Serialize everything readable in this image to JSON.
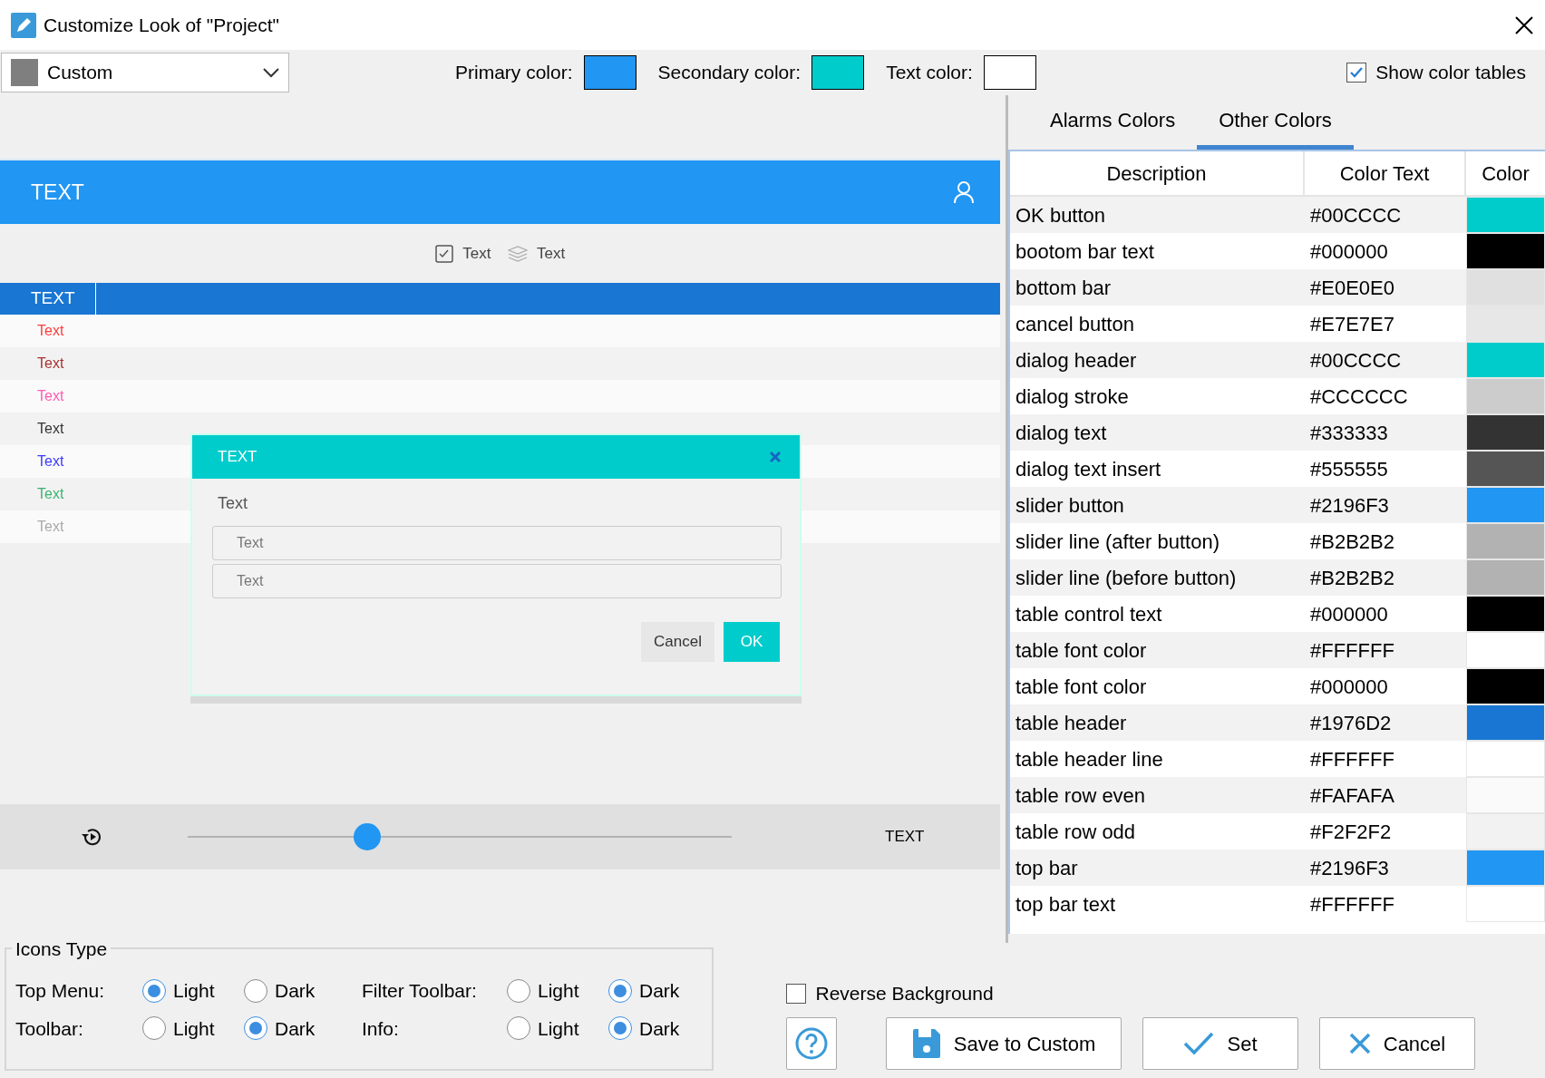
{
  "window": {
    "title": "Customize Look of \"Project\""
  },
  "scheme": {
    "value": "Custom"
  },
  "colors": [
    {
      "label": "Primary color:",
      "color": "#2196F3"
    },
    {
      "label": "Secondary color:",
      "color": "#00CCCC"
    },
    {
      "label": "Text color:",
      "color": "#FFFFFF"
    }
  ],
  "show_color_tables": {
    "label": "Show color tables",
    "checked": true
  },
  "preview": {
    "top_bar": {
      "title": "TEXT"
    },
    "toolbar": [
      {
        "kind": "check",
        "label": "Text"
      },
      {
        "kind": "layers",
        "label": "Text"
      }
    ],
    "table": {
      "header": "TEXT",
      "rows": [
        {
          "text": "Text",
          "color": "#FF3B3B"
        },
        {
          "text": "Text",
          "color": "#A83232"
        },
        {
          "text": "Text",
          "color": "#FF5CB0"
        },
        {
          "text": "Text",
          "color": "#333333"
        },
        {
          "text": "Text",
          "color": "#3A3AFF"
        },
        {
          "text": "Text",
          "color": "#3CB371"
        },
        {
          "text": "Text",
          "color": "#AAAAAA"
        }
      ]
    },
    "dialog": {
      "title": "TEXT",
      "label": "Text",
      "fields": [
        {
          "placeholder": "Text"
        },
        {
          "placeholder": "Text"
        }
      ],
      "buttons": [
        {
          "kind": "cancel",
          "label": "Cancel"
        },
        {
          "kind": "ok",
          "label": "OK"
        }
      ]
    },
    "bottom_bar": {
      "slider": {
        "level": 0.33
      },
      "label": "TEXT"
    }
  },
  "tabs": [
    {
      "label": "Alarms Colors",
      "selected": false
    },
    {
      "label": "Other Colors",
      "selected": true
    }
  ],
  "color_table": {
    "columns": [
      "Description",
      "Color Text",
      "Color"
    ],
    "rows": [
      {
        "description": "OK button",
        "color_text": "#00CCCC",
        "color": "#00CCCC"
      },
      {
        "description": "bootom bar text",
        "color_text": "#000000",
        "color": "#000000"
      },
      {
        "description": "bottom bar",
        "color_text": "#E0E0E0",
        "color": "#E0E0E0"
      },
      {
        "description": "cancel button",
        "color_text": "#E7E7E7",
        "color": "#E7E7E7"
      },
      {
        "description": "dialog header",
        "color_text": "#00CCCC",
        "color": "#00CCCC"
      },
      {
        "description": "dialog stroke",
        "color_text": "#CCCCCC",
        "color": "#CCCCCC"
      },
      {
        "description": "dialog text",
        "color_text": "#333333",
        "color": "#333333"
      },
      {
        "description": "dialog text insert",
        "color_text": "#555555",
        "color": "#555555"
      },
      {
        "description": "slider button",
        "color_text": "#2196F3",
        "color": "#2196F3"
      },
      {
        "description": "slider line (after button)",
        "color_text": "#B2B2B2",
        "color": "#B2B2B2"
      },
      {
        "description": "slider line (before button)",
        "color_text": "#B2B2B2",
        "color": "#B2B2B2"
      },
      {
        "description": "table control text",
        "color_text": "#000000",
        "color": "#000000"
      },
      {
        "description": "table font color",
        "color_text": "#FFFFFF",
        "color": "#FFFFFF"
      },
      {
        "description": "table font color",
        "color_text": "#000000",
        "color": "#000000"
      },
      {
        "description": "table header",
        "color_text": "#1976D2",
        "color": "#1976D2"
      },
      {
        "description": "table header line",
        "color_text": "#FFFFFF",
        "color": "#FFFFFF"
      },
      {
        "description": "table row even",
        "color_text": "#FAFAFA",
        "color": "#FAFAFA"
      },
      {
        "description": "table row odd",
        "color_text": "#F2F2F2",
        "color": "#F2F2F2"
      },
      {
        "description": "top bar",
        "color_text": "#2196F3",
        "color": "#2196F3"
      },
      {
        "description": "top bar text",
        "color_text": "#FFFFFF",
        "color": "#FFFFFF"
      }
    ]
  },
  "icons_type": {
    "title": "Icons Type",
    "groups": [
      {
        "label": "Top Menu:",
        "options": [
          {
            "label": "Light",
            "selected": true
          },
          {
            "label": "Dark",
            "selected": false
          }
        ]
      },
      {
        "label": "Filter Toolbar:",
        "options": [
          {
            "label": "Light",
            "selected": false
          },
          {
            "label": "Dark",
            "selected": true
          }
        ]
      },
      {
        "label": "Toolbar:",
        "options": [
          {
            "label": "Light",
            "selected": false
          },
          {
            "label": "Dark",
            "selected": true
          }
        ]
      },
      {
        "label": "Info:",
        "options": [
          {
            "label": "Light",
            "selected": false
          },
          {
            "label": "Dark",
            "selected": true
          }
        ]
      }
    ]
  },
  "reverse_background": {
    "label": "Reverse Background",
    "checked": false
  },
  "buttons": [
    {
      "kind": "help"
    },
    {
      "kind": "save",
      "label": "Save to Custom"
    },
    {
      "kind": "set",
      "label": "Set"
    },
    {
      "kind": "cancel",
      "label": "Cancel"
    }
  ]
}
